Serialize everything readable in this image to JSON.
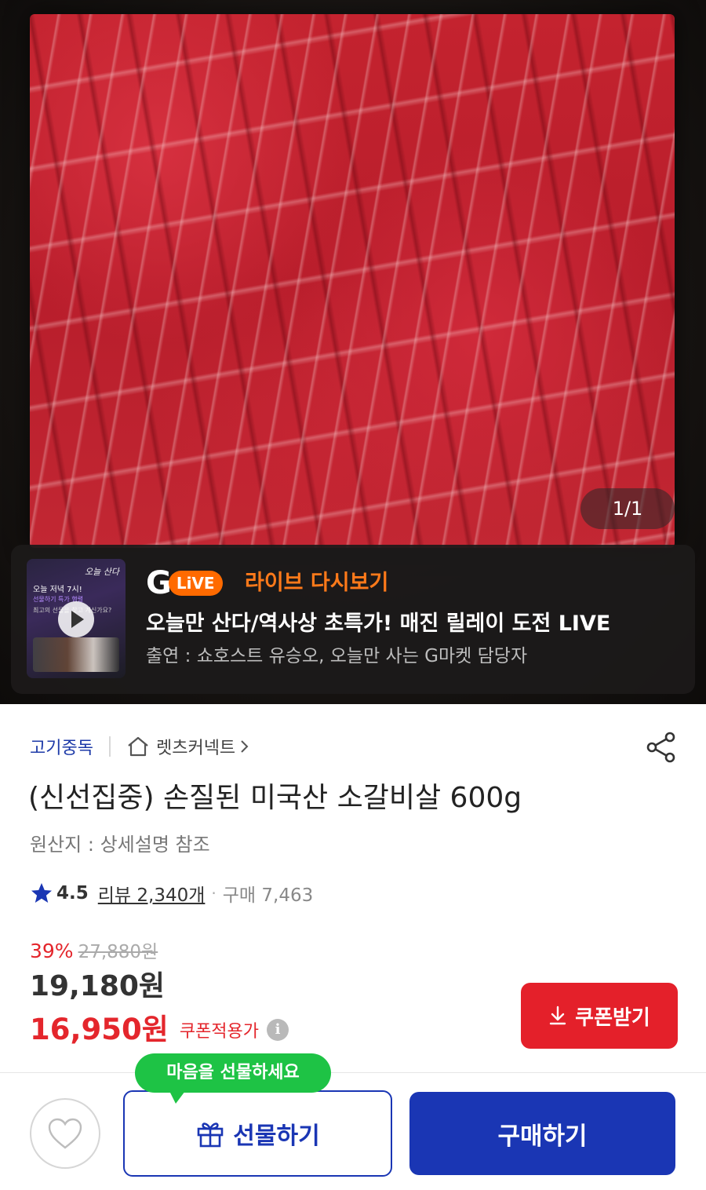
{
  "hero": {
    "image_alt": "",
    "counter": "1/1"
  },
  "live": {
    "logo_g": "G",
    "logo_live": "LiVE",
    "title": "라이브 다시보기",
    "headline": "오늘만 산다/역사상 초특가! 매진 릴레이 도전 LIVE",
    "cast": "출연 : 쇼호스트  유승오, 오늘만 사는 G마켓 담당자",
    "thumbnail": {
      "line1": "오늘 저녁 7시!",
      "line2": "선물하기 특가 행렬",
      "line3": "최고의 선물을 찾고 계신가요?",
      "script": "오늘 산다"
    }
  },
  "product": {
    "category": "고기중독",
    "shop": "렛츠커넥트",
    "title": "(신선집중) 손질된 미국산 소갈비살 600g",
    "origin": "원산지 : 상세설명 참조",
    "rating": "4.5",
    "reviews": "리뷰 2,340개",
    "purchases": "구매 7,463",
    "discount_rate": "39%",
    "original_price": "27,880원",
    "sale_price": "19,180원",
    "coupon_price": "16,950원",
    "coupon_label": "쿠폰적용가",
    "coupon_button": "쿠폰받기"
  },
  "bottom": {
    "tooltip": "마음을 선물하세요",
    "gift_button": "선물하기",
    "buy_button": "구매하기"
  },
  "colors": {
    "brand_blue": "#1a36b4",
    "sale_red": "#e4262c",
    "live_orange": "#ff7a1a",
    "tooltip_green": "#1ec345"
  },
  "icons": [
    "play-icon",
    "home-icon",
    "chevron-right-icon",
    "share-icon",
    "star-icon",
    "info-icon",
    "download-icon",
    "heart-icon",
    "gift-icon"
  ]
}
